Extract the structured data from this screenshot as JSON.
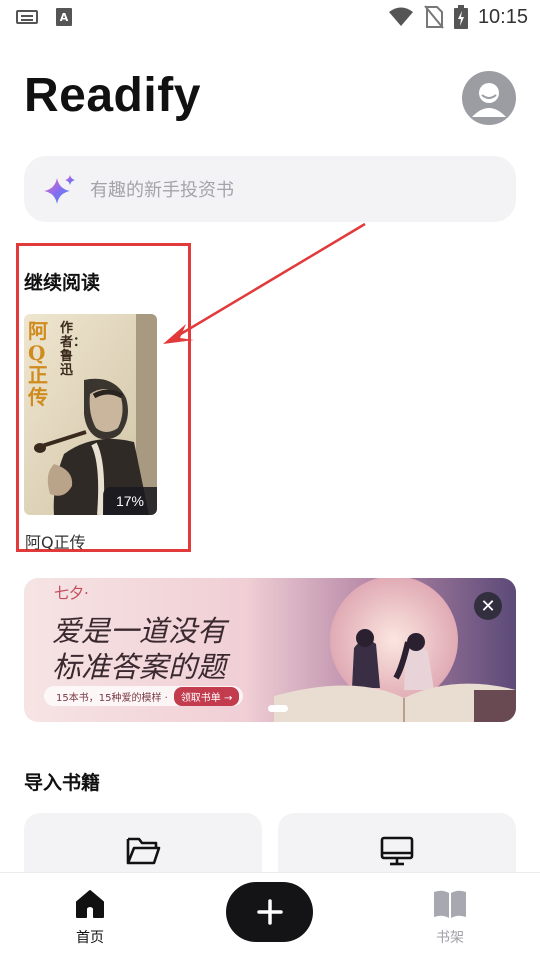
{
  "status_bar": {
    "time": "10:15",
    "left_icons": [
      "keyboard-icon",
      "a-icon"
    ],
    "a_letter": "A",
    "right_icons": [
      "wifi-icon",
      "no-sim-icon",
      "battery-charging-icon"
    ]
  },
  "header": {
    "title": "Readify",
    "avatar_icon": "user-avatar-icon"
  },
  "search": {
    "placeholder": "有趣的新手投资书",
    "icon": "sparkle-icon"
  },
  "continue_reading": {
    "title": "继续阅读",
    "books": [
      {
        "cover_title": "阿Q正传",
        "cover_author": "作者：鲁迅",
        "progress": "17%",
        "caption": "阿Q正传"
      }
    ]
  },
  "banner": {
    "small_title": "七夕·",
    "headline_line1": "爱是一道没有",
    "headline_line2": "标准答案的题",
    "cta_text": "15本书，15种爱的模样 ·",
    "cta_button": "领取书单 →",
    "close_icon": "close-icon"
  },
  "import_books": {
    "title": "导入书籍",
    "options": [
      {
        "icon": "folder-icon"
      },
      {
        "icon": "monitor-icon"
      }
    ]
  },
  "bottom_nav": {
    "home_label": "首页",
    "add_icon": "plus-icon",
    "shelf_label": "书架"
  },
  "colors": {
    "accent_dark": "#141416",
    "highlight_red": "#e23a3a",
    "search_bg": "#f3f3f6",
    "placeholder": "#a3a3aa"
  }
}
